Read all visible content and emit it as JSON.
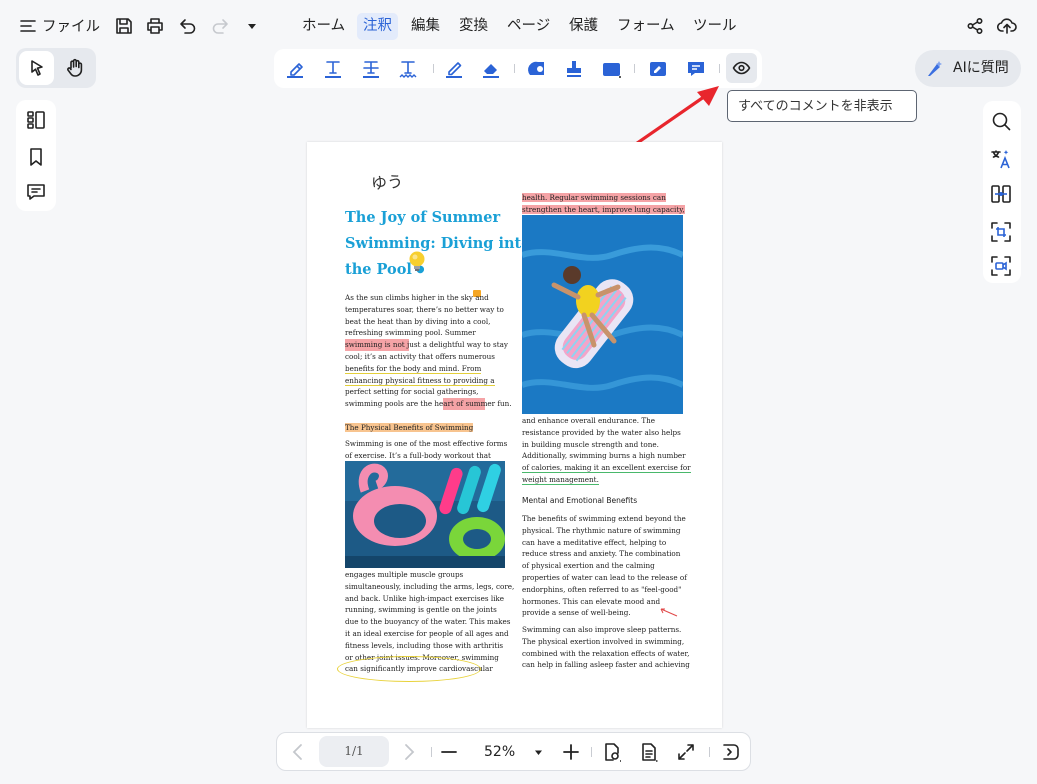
{
  "menubar": {
    "file_label": "ファイル",
    "tabs": [
      {
        "label": "ホーム",
        "active": false
      },
      {
        "label": "注釈",
        "active": true
      },
      {
        "label": "編集",
        "active": false
      },
      {
        "label": "変換",
        "active": false
      },
      {
        "label": "ページ",
        "active": false
      },
      {
        "label": "保護",
        "active": false
      },
      {
        "label": "フォーム",
        "active": false
      },
      {
        "label": "ツール",
        "active": false
      }
    ]
  },
  "ai_button": {
    "label": "AIに質問"
  },
  "tooltip": {
    "text": "すべてのコメントを非表示"
  },
  "accent_color": "#2b63d6",
  "arrow_color": "#e8262d",
  "document": {
    "handwriting": "ゆう",
    "title_lines": [
      "The Joy of Summer",
      "Swimming: Diving into",
      "the Pool"
    ],
    "left_col_1": [
      "As the sun climbs higher in the sky and",
      "temperatures soar, there’s no better way to",
      "beat the heat than by diving into a cool,",
      "refreshing swimming pool. Summer",
      "swimming is not just a delightful way to stay",
      "cool; it’s an activity that offers numerous",
      "benefits for the body and mind. From",
      "enhancing physical fitness to providing a",
      "perfect setting for social gatherings,",
      "swimming pools are the heart of summer fun."
    ],
    "left_heading": "The Physical Benefits of Swimming",
    "left_col_2": [
      "Swimming is one of the most effective forms",
      "of exercise. It’s a full-body workout that"
    ],
    "left_col_3": [
      "engages multiple muscle groups",
      "simultaneously, including the arms, legs, core,",
      "and back. Unlike high-impact exercises like",
      "running, swimming is gentle on the joints",
      "due to the buoyancy of the water. This makes",
      "it an ideal exercise for people of all ages and",
      "fitness levels, including those with arthritis",
      "or other joint issues. Moreover, swimming",
      "can significantly improve cardiovascular"
    ],
    "right_top": [
      "health. Regular swimming sessions can",
      "strengthen the heart, improve lung capacity,"
    ],
    "right_col_1": [
      "and enhance overall endurance. The",
      "resistance provided by the water also helps",
      "in building muscle strength and tone.",
      "Additionally, swimming burns a high number",
      "of calories, making it an excellent exercise for",
      "weight management."
    ],
    "right_heading": "Mental and Emotional Benefits",
    "right_col_2": [
      "The benefits of swimming extend beyond the",
      "physical. The rhythmic nature of swimming",
      "can have a meditative effect, helping to",
      "reduce stress and anxiety. The combination",
      "of physical exertion and the calming",
      "properties of water can lead to the release of",
      "endorphins, often referred to as \"feel-good\"",
      "hormones. This can elevate mood and",
      "provide a sense of well-being."
    ],
    "right_col_3": [
      "Swimming can also improve sleep patterns.",
      "The physical exertion involved in swimming,",
      "combined with the relaxation effects of water,",
      "can help in falling asleep faster and achieving"
    ]
  },
  "pagination": {
    "page_indicator": "1/1",
    "zoom": "52%"
  }
}
